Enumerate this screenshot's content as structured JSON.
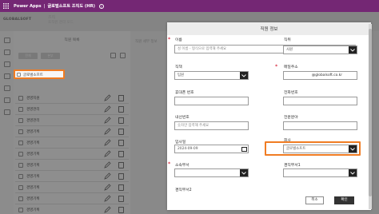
{
  "topbar": {
    "app_name": "Power Apps",
    "separator": "|",
    "title": "글로벌소프트 조직도 (HR)"
  },
  "background": {
    "logo": "GLOBALSOFT",
    "header_line1": "조직",
    "header_line2": "조직원 관리 모드",
    "list_title": "직원 목록",
    "mid_tab": "직원 세부 정보",
    "buttons": [
      "전체",
      "본부"
    ],
    "highlighted_row": "글로벌소프트",
    "rows": [
      "경영지원",
      "경영관리",
      "경영관리",
      "경영기획",
      "경영기획",
      "경영기획",
      "경영기획",
      "경영기획",
      "경영기획",
      "경영기획",
      "경영기획"
    ]
  },
  "dialog": {
    "title": "직원 정보",
    "fields": {
      "name": {
        "label": "이름",
        "placeholder": "성 이름 - 형식으로 입력해 주세요"
      },
      "position": {
        "label": "직위",
        "value": "사원"
      },
      "job_title": {
        "label": "직책",
        "value": "팀원"
      },
      "email": {
        "label": "메일주소",
        "value": "",
        "suffix": "@globalsoft.co.kr"
      },
      "mobile": {
        "label": "휴대폰 번호",
        "value": ""
      },
      "phone": {
        "label": "전화번호",
        "value": ""
      },
      "extension": {
        "label": "내선번호",
        "placeholder": "숫자만 입력해 주세요"
      },
      "duty": {
        "label": "전문분야",
        "value": ""
      },
      "join_date": {
        "label": "입사일",
        "value": "2024-09-09"
      },
      "company": {
        "label": "회사",
        "value": "글로벌소프트"
      },
      "department": {
        "label": "소속부서",
        "value": ""
      },
      "dual_department1": {
        "label": "겸직부서1",
        "value": ""
      },
      "dual_department2": {
        "label": "겸직부서2"
      }
    },
    "cancel_label": "취소",
    "ok_label": "확인"
  },
  "colors": {
    "topbar": "#742774",
    "highlight": "#f07c23",
    "required": "#d0021b"
  }
}
